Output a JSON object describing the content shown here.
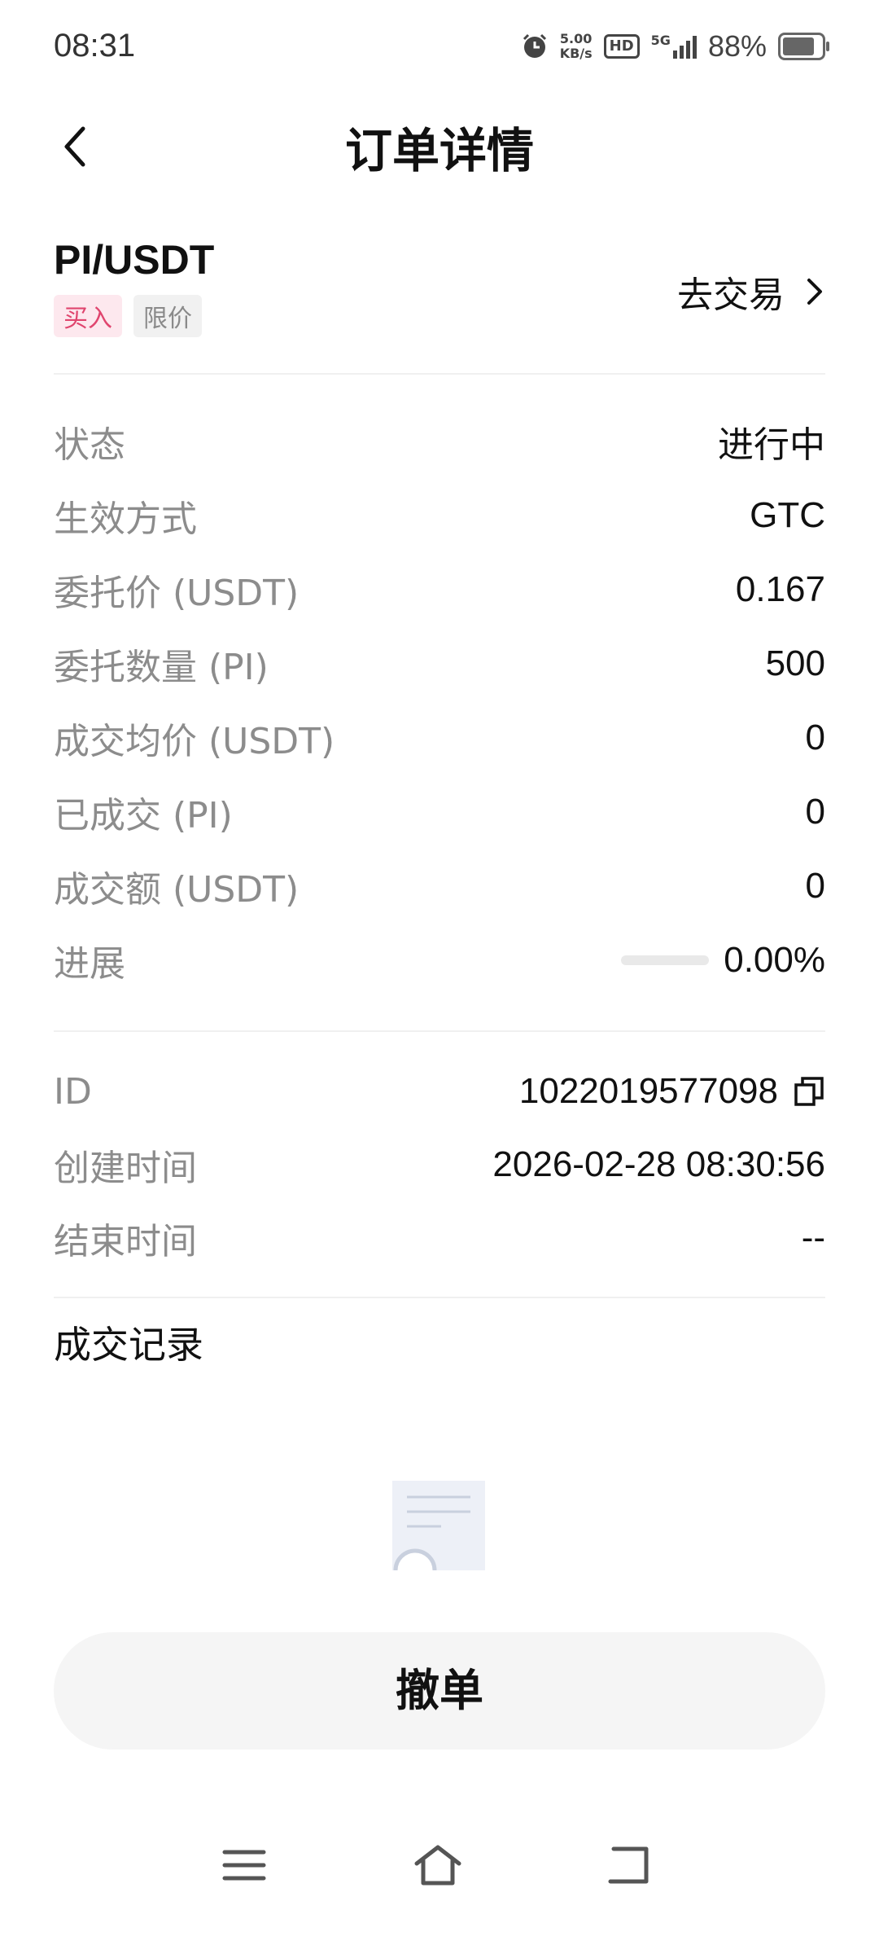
{
  "status_bar": {
    "time": "08:31",
    "net_speed_value": "5.00",
    "net_speed_unit": "KB/s",
    "hd": "HD",
    "network": "5G",
    "battery": "88%"
  },
  "header": {
    "title": "订单详情"
  },
  "pair": {
    "symbol": "PI/USDT",
    "side_tag": "买入",
    "type_tag": "限价",
    "go_trade": "去交易"
  },
  "details": [
    {
      "label": "状态",
      "value": "进行中"
    },
    {
      "label": "生效方式",
      "value": "GTC"
    },
    {
      "label": "委托价 (USDT)",
      "value": "0.167"
    },
    {
      "label": "委托数量 (PI)",
      "value": "500"
    },
    {
      "label": "成交均价 (USDT)",
      "value": "0"
    },
    {
      "label": "已成交 (PI)",
      "value": "0"
    },
    {
      "label": "成交额 (USDT)",
      "value": "0"
    }
  ],
  "progress": {
    "label": "进展",
    "value": "0.00%",
    "fraction": 0.0
  },
  "meta": [
    {
      "label": "ID",
      "value": "1022019577098"
    },
    {
      "label": "创建时间",
      "value": "2026-02-28 08:30:56"
    },
    {
      "label": "结束时间",
      "value": "--"
    }
  ],
  "trades": {
    "title": "成交记录"
  },
  "actions": {
    "cancel": "撤单"
  },
  "colors": {
    "buy_tag": "#e0456e",
    "buy_tag_bg": "#fde8ee",
    "muted": "#8c8c8c"
  }
}
